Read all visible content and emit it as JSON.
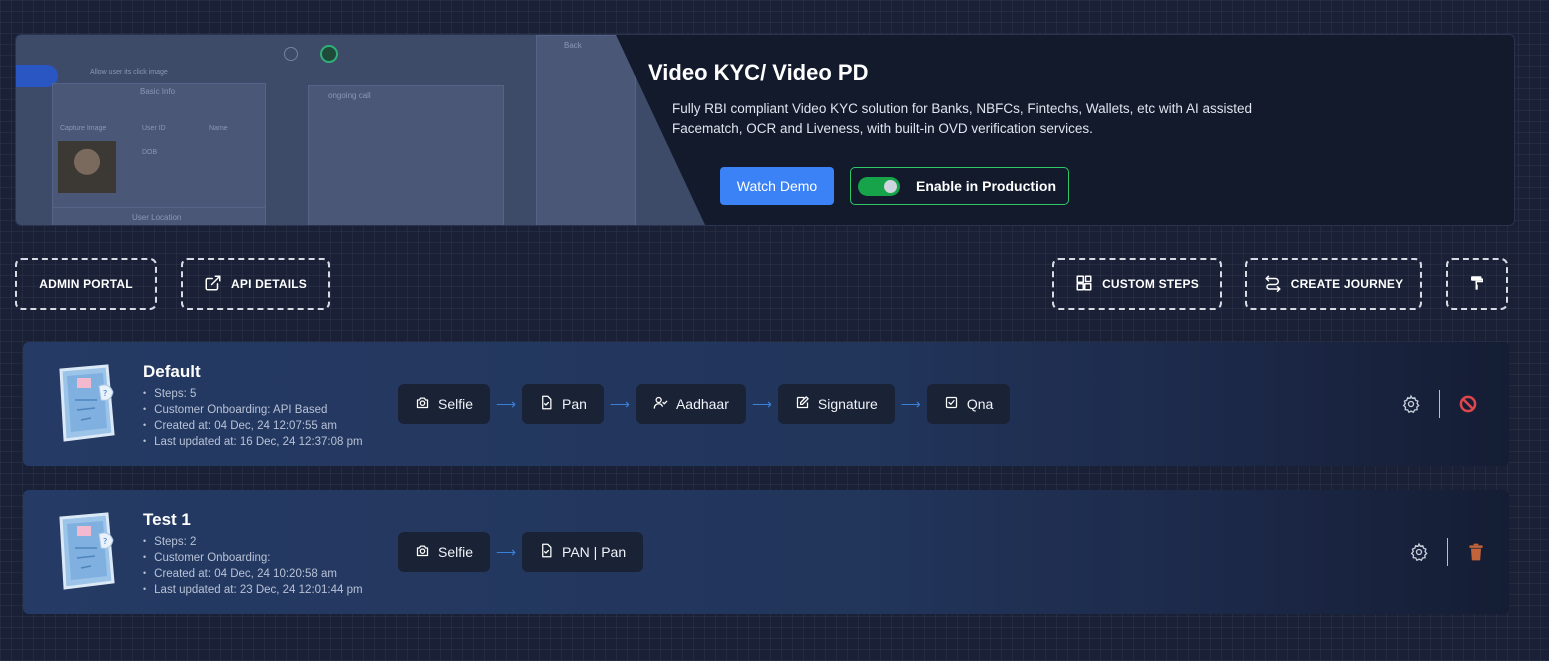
{
  "hero": {
    "title": "Video KYC/ Video PD",
    "description": "Fully RBI compliant Video KYC solution for Banks, NBFCs, Fintechs, Wallets, etc with AI assisted Facematch, OCR and Liveness, with built-in OVD verification services.",
    "watch_demo_label": "Watch Demo",
    "production_label": "Enable in Production",
    "production_enabled": true,
    "preview": {
      "allow_text": "Allow user its click image",
      "basic_info": "Basic Info",
      "capture_image": "Capture Image",
      "user_id": "User ID",
      "name": "Name",
      "dob": "DOB",
      "user_location": "User Location",
      "ongoing_call": "ongoing call",
      "back": "Back"
    }
  },
  "toolbar": {
    "admin_portal": "ADMIN PORTAL",
    "api_details": "API DETAILS",
    "custom_steps": "CUSTOM STEPS",
    "create_journey": "CREATE JOURNEY"
  },
  "journeys": [
    {
      "name": "Default",
      "steps_count": "Steps: 5",
      "onboarding": "Customer Onboarding: API Based",
      "created": "Created at: 04 Dec, 24 12:07:55 am",
      "updated": "Last updated at: 16 Dec, 24 12:37:08 pm",
      "steps": [
        "Selfie",
        "Pan",
        "Aadhaar",
        "Signature",
        "Qna"
      ],
      "action_icon": "block-icon"
    },
    {
      "name": "Test 1",
      "steps_count": "Steps: 2",
      "onboarding": "Customer Onboarding:",
      "created": "Created at: 04 Dec, 24 10:20:58 am",
      "updated": "Last updated at: 23 Dec, 24 12:01:44 pm",
      "steps": [
        "Selfie",
        "PAN | Pan"
      ],
      "action_icon": "trash-icon"
    }
  ],
  "colors": {
    "accent_blue": "#3b82f6",
    "toggle_green": "#16a34a",
    "block_red": "#e0464b",
    "trash_orange": "#c2643a"
  }
}
